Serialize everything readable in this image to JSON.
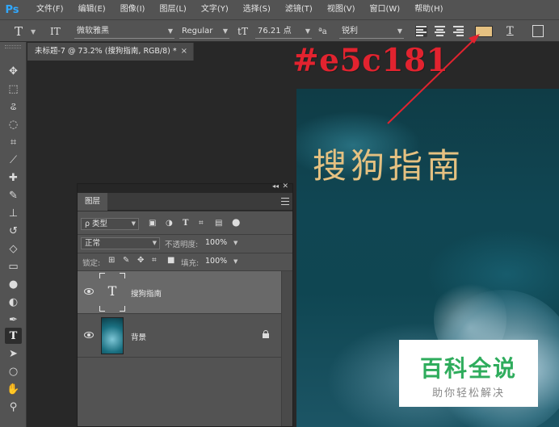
{
  "app": {
    "logo": "Ps"
  },
  "menu": [
    "文件(F)",
    "编辑(E)",
    "图像(I)",
    "图层(L)",
    "文字(Y)",
    "选择(S)",
    "滤镜(T)",
    "视图(V)",
    "窗口(W)",
    "帮助(H)"
  ],
  "options": {
    "tool_glyph": "T",
    "orient_glyph": "IT",
    "font_family": "微软雅黑",
    "font_style": "Regular",
    "size_glyph": "tT",
    "font_size": "76.21 点",
    "aa_glyph": "ªa",
    "antialias": "锐利",
    "text_color": "#e5c181",
    "warp_glyph": "T"
  },
  "document": {
    "tab_title": "未标题-7 @ 73.2% (搜狗指南, RGB/8) *",
    "close": "×"
  },
  "canvas": {
    "text": "搜狗指南",
    "text_color": "#e5c181"
  },
  "annotation": {
    "text": "#e5c181",
    "color": "#e2232f"
  },
  "layers_panel": {
    "collapse": "◂◂",
    "close": "✕",
    "tab": "图层",
    "filter_label": "ρ 类型",
    "filter_icons": [
      "image-filter-icon",
      "adjustment-filter-icon",
      "type-filter-icon",
      "shape-filter-icon",
      "smart-object-filter-icon",
      "filter-toggle-icon"
    ],
    "blend_mode": "正常",
    "opacity_label": "不透明度:",
    "opacity": "100%",
    "lock_label": "锁定:",
    "fill_label": "填充:",
    "fill": "100%",
    "layers": [
      {
        "name": "搜狗指南",
        "kind": "text",
        "selected": true,
        "thumb_glyph": "T"
      },
      {
        "name": "背景",
        "kind": "image",
        "selected": false,
        "locked": true
      }
    ]
  },
  "watermark": {
    "main": "百科全说",
    "sub": "助你轻松解决",
    "color": "#2eac5c"
  }
}
